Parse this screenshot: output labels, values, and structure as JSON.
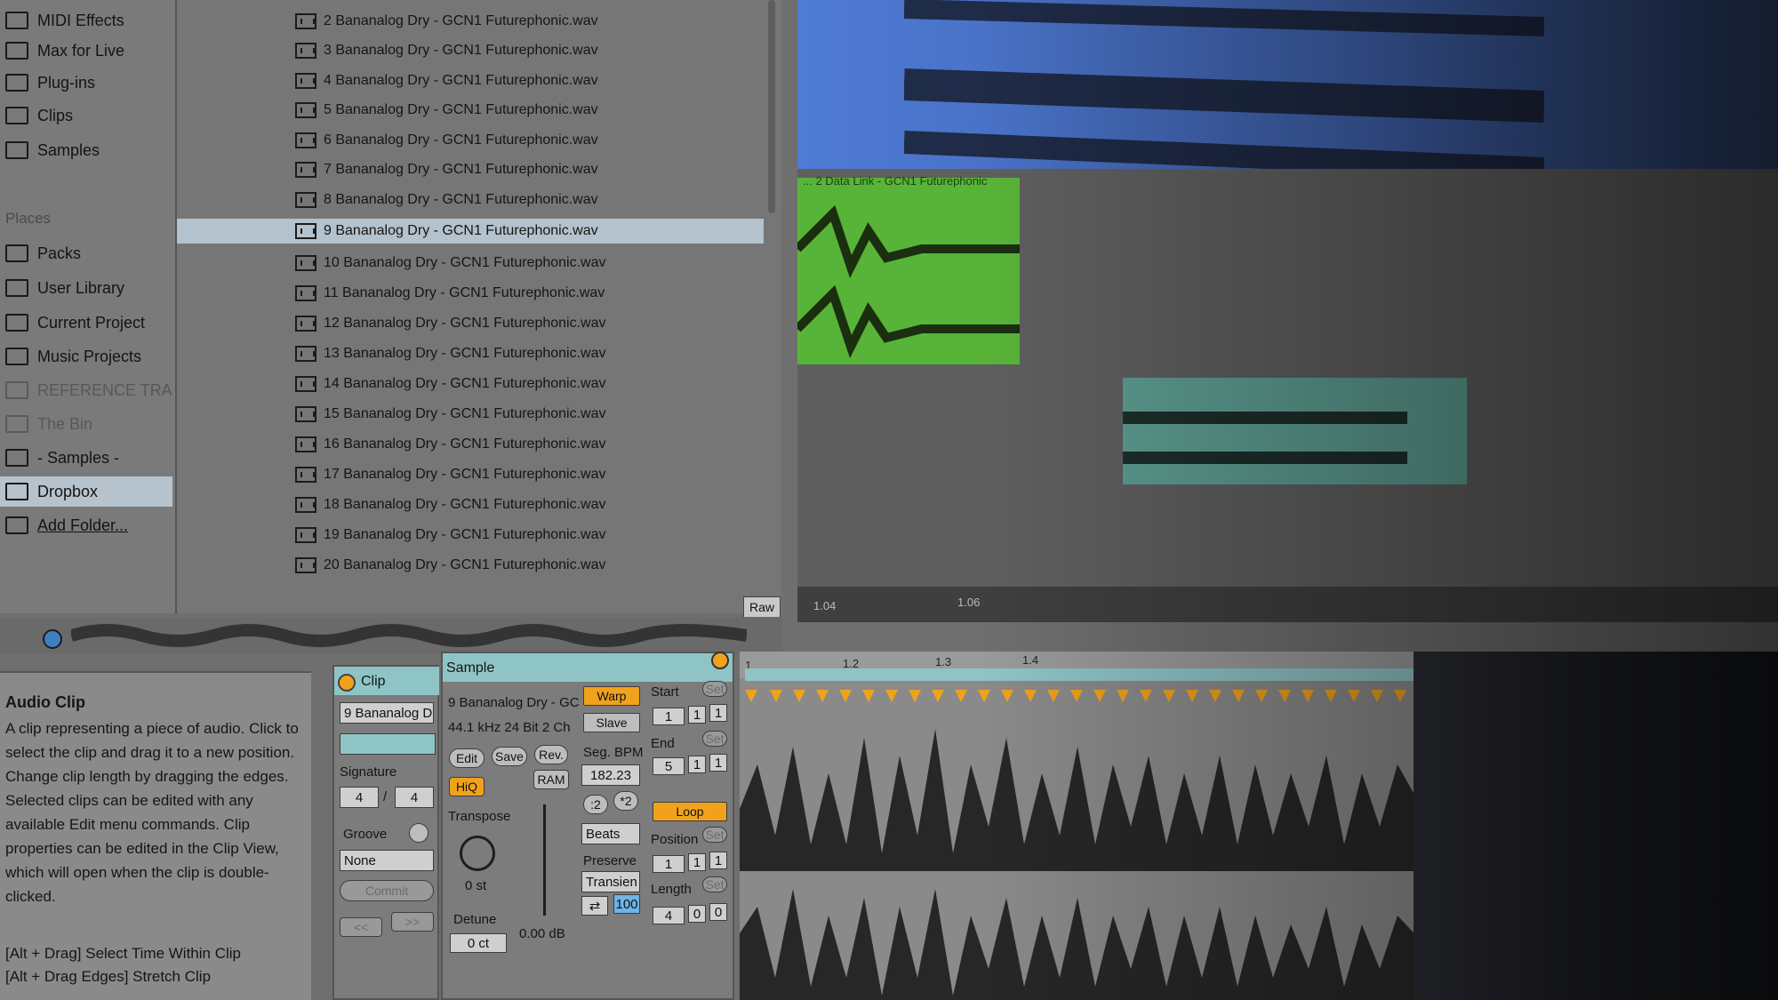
{
  "sidebar": {
    "items_top": [
      {
        "label": "MIDI Effects",
        "icon": "midi-effects-icon"
      },
      {
        "label": "Max for Live",
        "icon": "max-for-live-icon"
      },
      {
        "label": "Plug-ins",
        "icon": "plugins-icon"
      },
      {
        "label": "Clips",
        "icon": "clips-icon"
      },
      {
        "label": "Samples",
        "icon": "samples-icon"
      }
    ],
    "places_heading": "Places",
    "places": [
      {
        "label": "Packs",
        "icon": "packs-icon"
      },
      {
        "label": "User Library",
        "icon": "user-icon"
      },
      {
        "label": "Current Project",
        "icon": "project-icon"
      },
      {
        "label": "Music Projects",
        "icon": "folder-icon"
      },
      {
        "label": "REFERENCE TRA",
        "icon": "folder-icon"
      },
      {
        "label": "The Bin",
        "icon": "folder-icon"
      },
      {
        "label": "- Samples -",
        "icon": "folder-icon"
      },
      {
        "label": "Dropbox",
        "icon": "folder-icon"
      },
      {
        "label": "Add Folder...",
        "icon": "add-folder-icon"
      }
    ]
  },
  "files": [
    "2 Bananalog Dry - GCN1 Futurephonic.wav",
    "3 Bananalog Dry - GCN1 Futurephonic.wav",
    "4 Bananalog Dry - GCN1 Futurephonic.wav",
    "5 Bananalog Dry - GCN1 Futurephonic.wav",
    "6 Bananalog Dry - GCN1 Futurephonic.wav",
    "7 Bananalog Dry - GCN1 Futurephonic.wav",
    "8 Bananalog Dry - GCN1 Futurephonic.wav",
    "9 Bananalog Dry - GCN1 Futurephonic.wav",
    "10 Bananalog Dry - GCN1 Futurephonic.wav",
    "11 Bananalog Dry - GCN1 Futurephonic.wav",
    "12 Bananalog Dry - GCN1 Futurephonic.wav",
    "13 Bananalog Dry - GCN1 Futurephonic.wav",
    "14 Bananalog Dry - GCN1 Futurephonic.wav",
    "15 Bananalog Dry - GCN1 Futurephonic.wav",
    "16 Bananalog Dry - GCN1 Futurephonic.wav",
    "17 Bananalog Dry - GCN1 Futurephonic.wav",
    "18 Bananalog Dry - GCN1 Futurephonic.wav",
    "19 Bananalog Dry - GCN1 Futurephonic.wav",
    "20 Bananalog Dry - GCN1 Futurephonic.wav"
  ],
  "preview": {
    "raw_label": "Raw"
  },
  "arrangement": {
    "green_clip_label": "... 2 Data Link - GCN1 Futurephonic",
    "timeline_labels": [
      "1.04",
      "1.06"
    ]
  },
  "info": {
    "title": "Audio Clip",
    "body": "A clip representing a piece of audio. Click to select the clip and drag it to a new position. Change clip length by dragging the edges. Selected clips can be edited with any available Edit menu commands. Clip properties can be edited in the Clip View, which will open when the clip is double-clicked.",
    "hint1": "[Alt + Drag] Select Time Within Clip",
    "hint2": "[Alt + Drag Edges] Stretch Clip"
  },
  "clip_panel": {
    "title": "Clip",
    "name_value": "9 Bananalog D",
    "signature_label": "Signature",
    "sig_num": "4",
    "sig_sep": "/",
    "sig_den": "4",
    "groove_label": "Groove",
    "groove_value": "None",
    "commit_label": "Commit",
    "prev_label": "<<",
    "next_label": ">>"
  },
  "sample_panel": {
    "title": "Sample",
    "file_name": "9 Bananalog Dry - GC",
    "format": "44.1 kHz 24 Bit 2 Ch",
    "edit_label": "Edit",
    "save_label": "Save",
    "rev_label": "Rev.",
    "hiq_label": "HiQ",
    "ram_label": "RAM",
    "transpose_label": "Transpose",
    "transpose_value": "0 st",
    "detune_label": "Detune",
    "detune_value": "0 ct",
    "volume_value": "0.00 dB",
    "warp_label": "Warp",
    "slave_label": "Slave",
    "seg_bpm_label": "Seg. BPM",
    "seg_bpm_value": "182.23",
    "half_label": ":2",
    "double_label": "*2",
    "warp_mode": "Beats",
    "preserve_label": "Preserve",
    "preserve_value": "Transien",
    "loop_mode_value": "100",
    "start_label": "Start",
    "start_values": [
      "1",
      "1",
      "1"
    ],
    "end_label": "End",
    "end_values": [
      "5",
      "1",
      "1"
    ],
    "loop_label": "Loop",
    "position_label": "Position",
    "position_values": [
      "1",
      "1",
      "1"
    ],
    "length_label": "Length",
    "length_values": [
      "4",
      "0",
      "0"
    ],
    "set_label": "Set"
  },
  "editor": {
    "ruler_labels": [
      "1",
      "1.2",
      "1.3",
      "1.4"
    ]
  },
  "colors": {
    "accent_orange": "#f0a21c",
    "clip_teal": "#8fc4c6",
    "track_blue": "#4f7bd6",
    "track_green": "#58b438",
    "selection": "#b3c2cc"
  }
}
